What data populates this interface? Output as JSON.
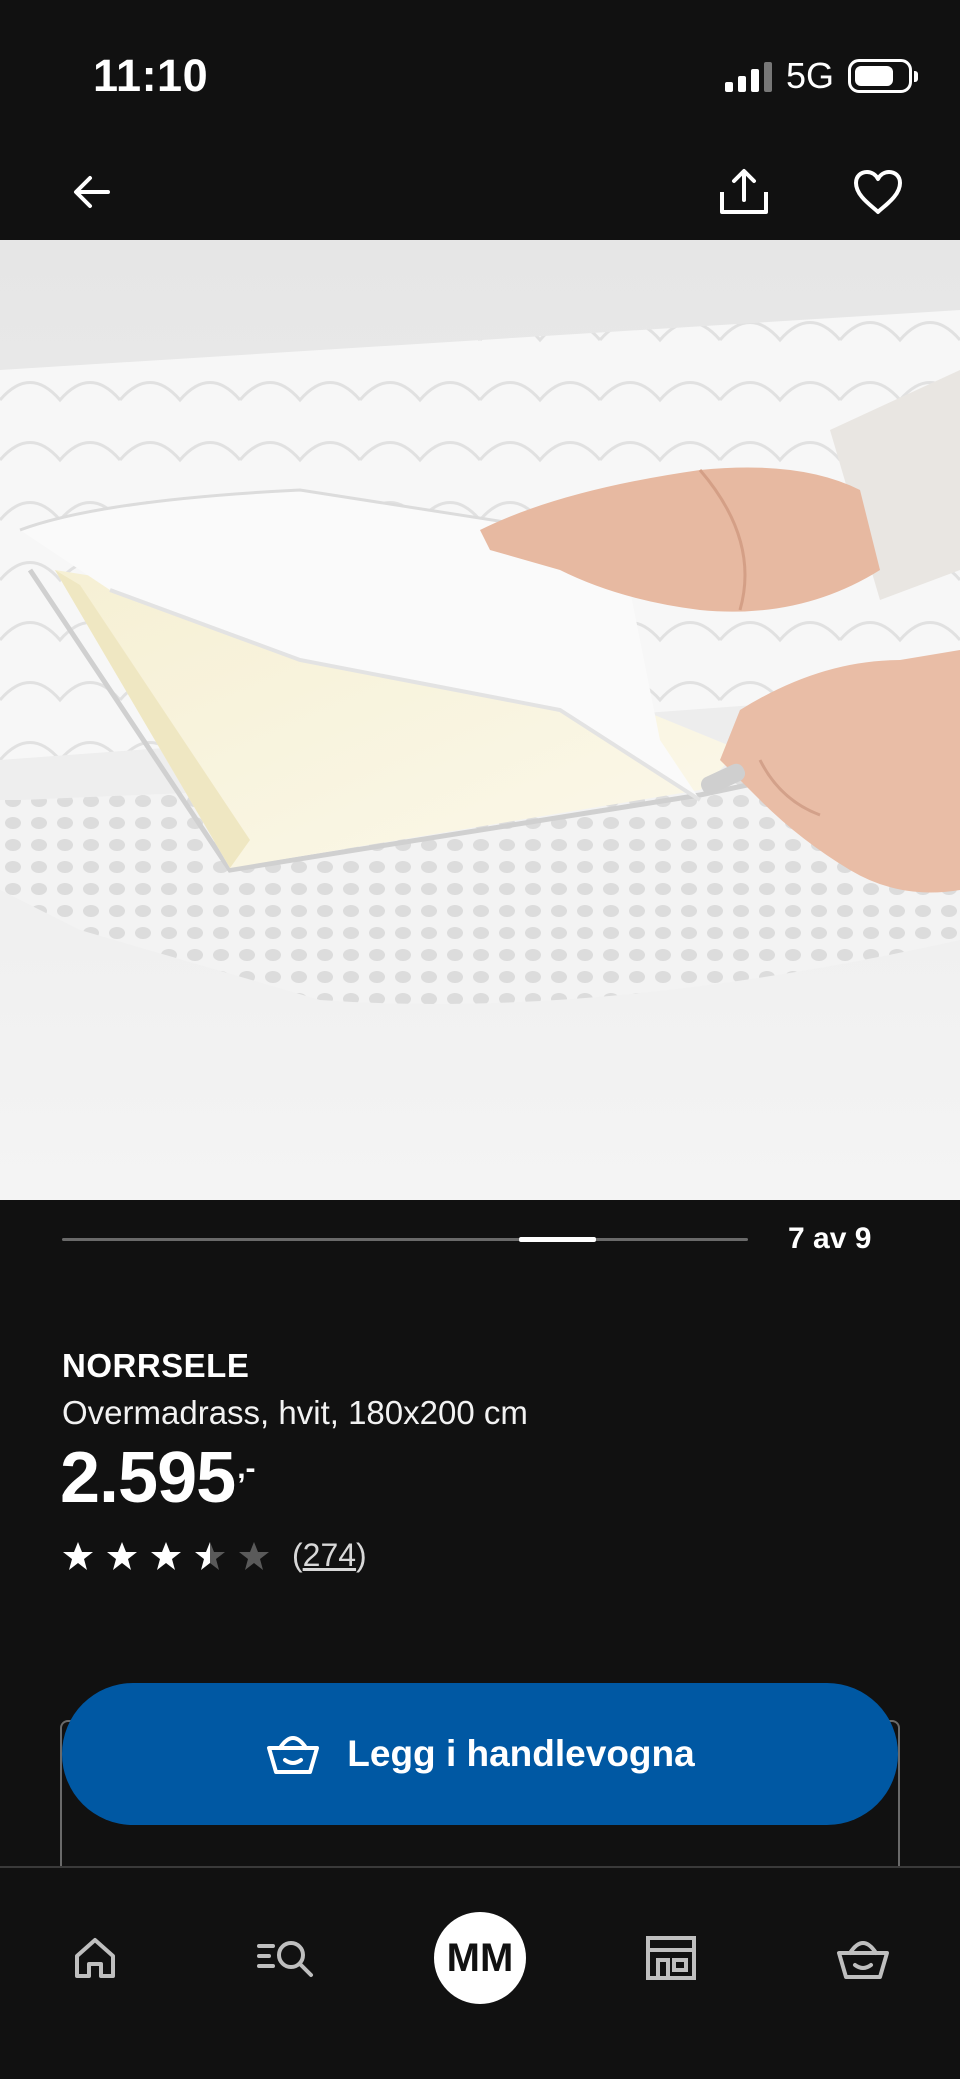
{
  "status_bar": {
    "time": "11:10",
    "network": "5G"
  },
  "product": {
    "name": "NORRSELE",
    "description": "Overmadrass, hvit, 180x200 cm",
    "price": "2.595",
    "price_suffix": ",-",
    "rating": 3.5,
    "rating_max": 5,
    "review_count": "274",
    "review_open": "(",
    "review_close": ")"
  },
  "gallery": {
    "counter": "7 av 9",
    "current": 7,
    "total": 9
  },
  "actions": {
    "add_to_cart_label": "Legg i handlevogna"
  },
  "tab_bar": {
    "items": [
      {
        "icon": "home-icon"
      },
      {
        "icon": "search-icon"
      },
      {
        "icon": "profile-avatar",
        "initials": "MM"
      },
      {
        "icon": "store-icon"
      },
      {
        "icon": "cart-icon"
      }
    ]
  },
  "colors": {
    "background": "#111111",
    "primary_button": "#0058a3",
    "text": "#ffffff",
    "star_filled": "#ffffff",
    "star_empty": "#5a5a5a"
  }
}
